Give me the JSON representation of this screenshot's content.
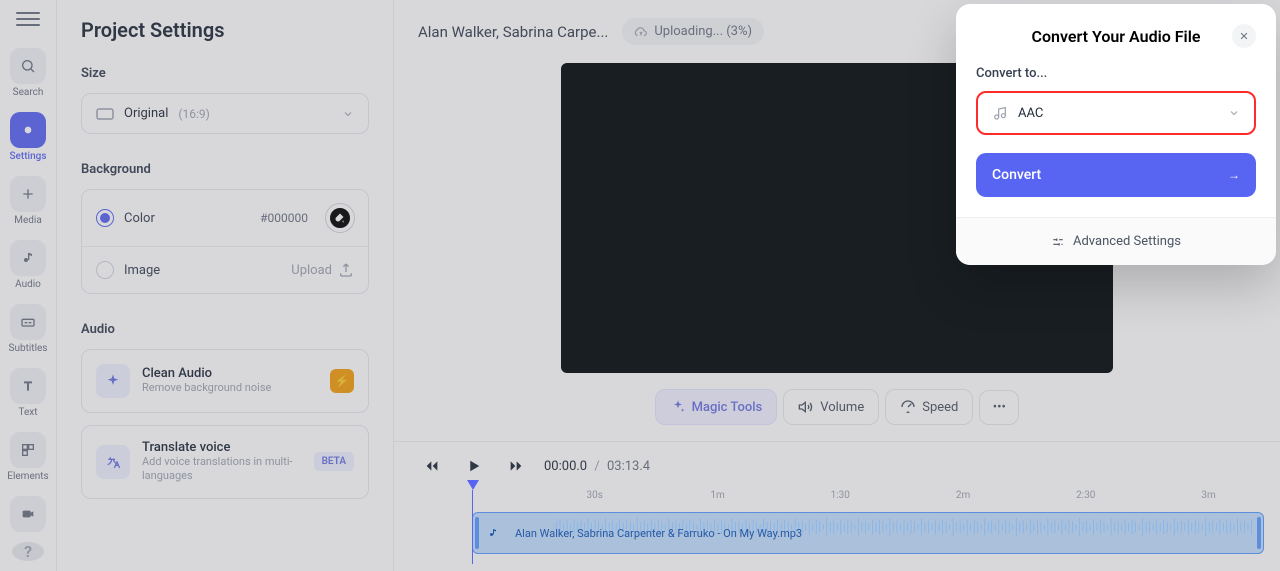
{
  "nav": {
    "items": [
      {
        "label": "Search"
      },
      {
        "label": "Settings"
      },
      {
        "label": "Media"
      },
      {
        "label": "Audio"
      },
      {
        "label": "Subtitles"
      },
      {
        "label": "Text"
      },
      {
        "label": "Elements"
      },
      {
        "label": "Record"
      }
    ]
  },
  "settings": {
    "title": "Project Settings",
    "size": {
      "label": "Size",
      "option": "Original",
      "ratio": "(16:9)"
    },
    "background": {
      "label": "Background",
      "color_option": "Color",
      "color_value": "#000000",
      "image_option": "Image",
      "upload_label": "Upload"
    },
    "audio": {
      "label": "Audio",
      "clean_title": "Clean Audio",
      "clean_sub": "Remove background noise",
      "translate_title": "Translate voice",
      "translate_sub": "Add voice translations in multi-languages",
      "beta_badge": "BETA"
    }
  },
  "main": {
    "project_title": "Alan Walker, Sabrina Carpe...",
    "upload_status": "Uploading... (3%)",
    "tools": {
      "magic": "Magic Tools",
      "volume": "Volume",
      "speed": "Speed"
    },
    "time": {
      "current": "00:00.0",
      "separator": "/",
      "total": "03:13.4"
    },
    "ruler_ticks": [
      "30s",
      "1m",
      "1:30",
      "2m",
      "2:30",
      "3m"
    ],
    "clip_label": "Alan Walker, Sabrina Carpenter & Farruko - On My Way.mp3"
  },
  "modal": {
    "title": "Convert Your Audio File",
    "convert_label": "Convert to...",
    "format": "AAC",
    "button": "Convert",
    "advanced": "Advanced Settings"
  }
}
